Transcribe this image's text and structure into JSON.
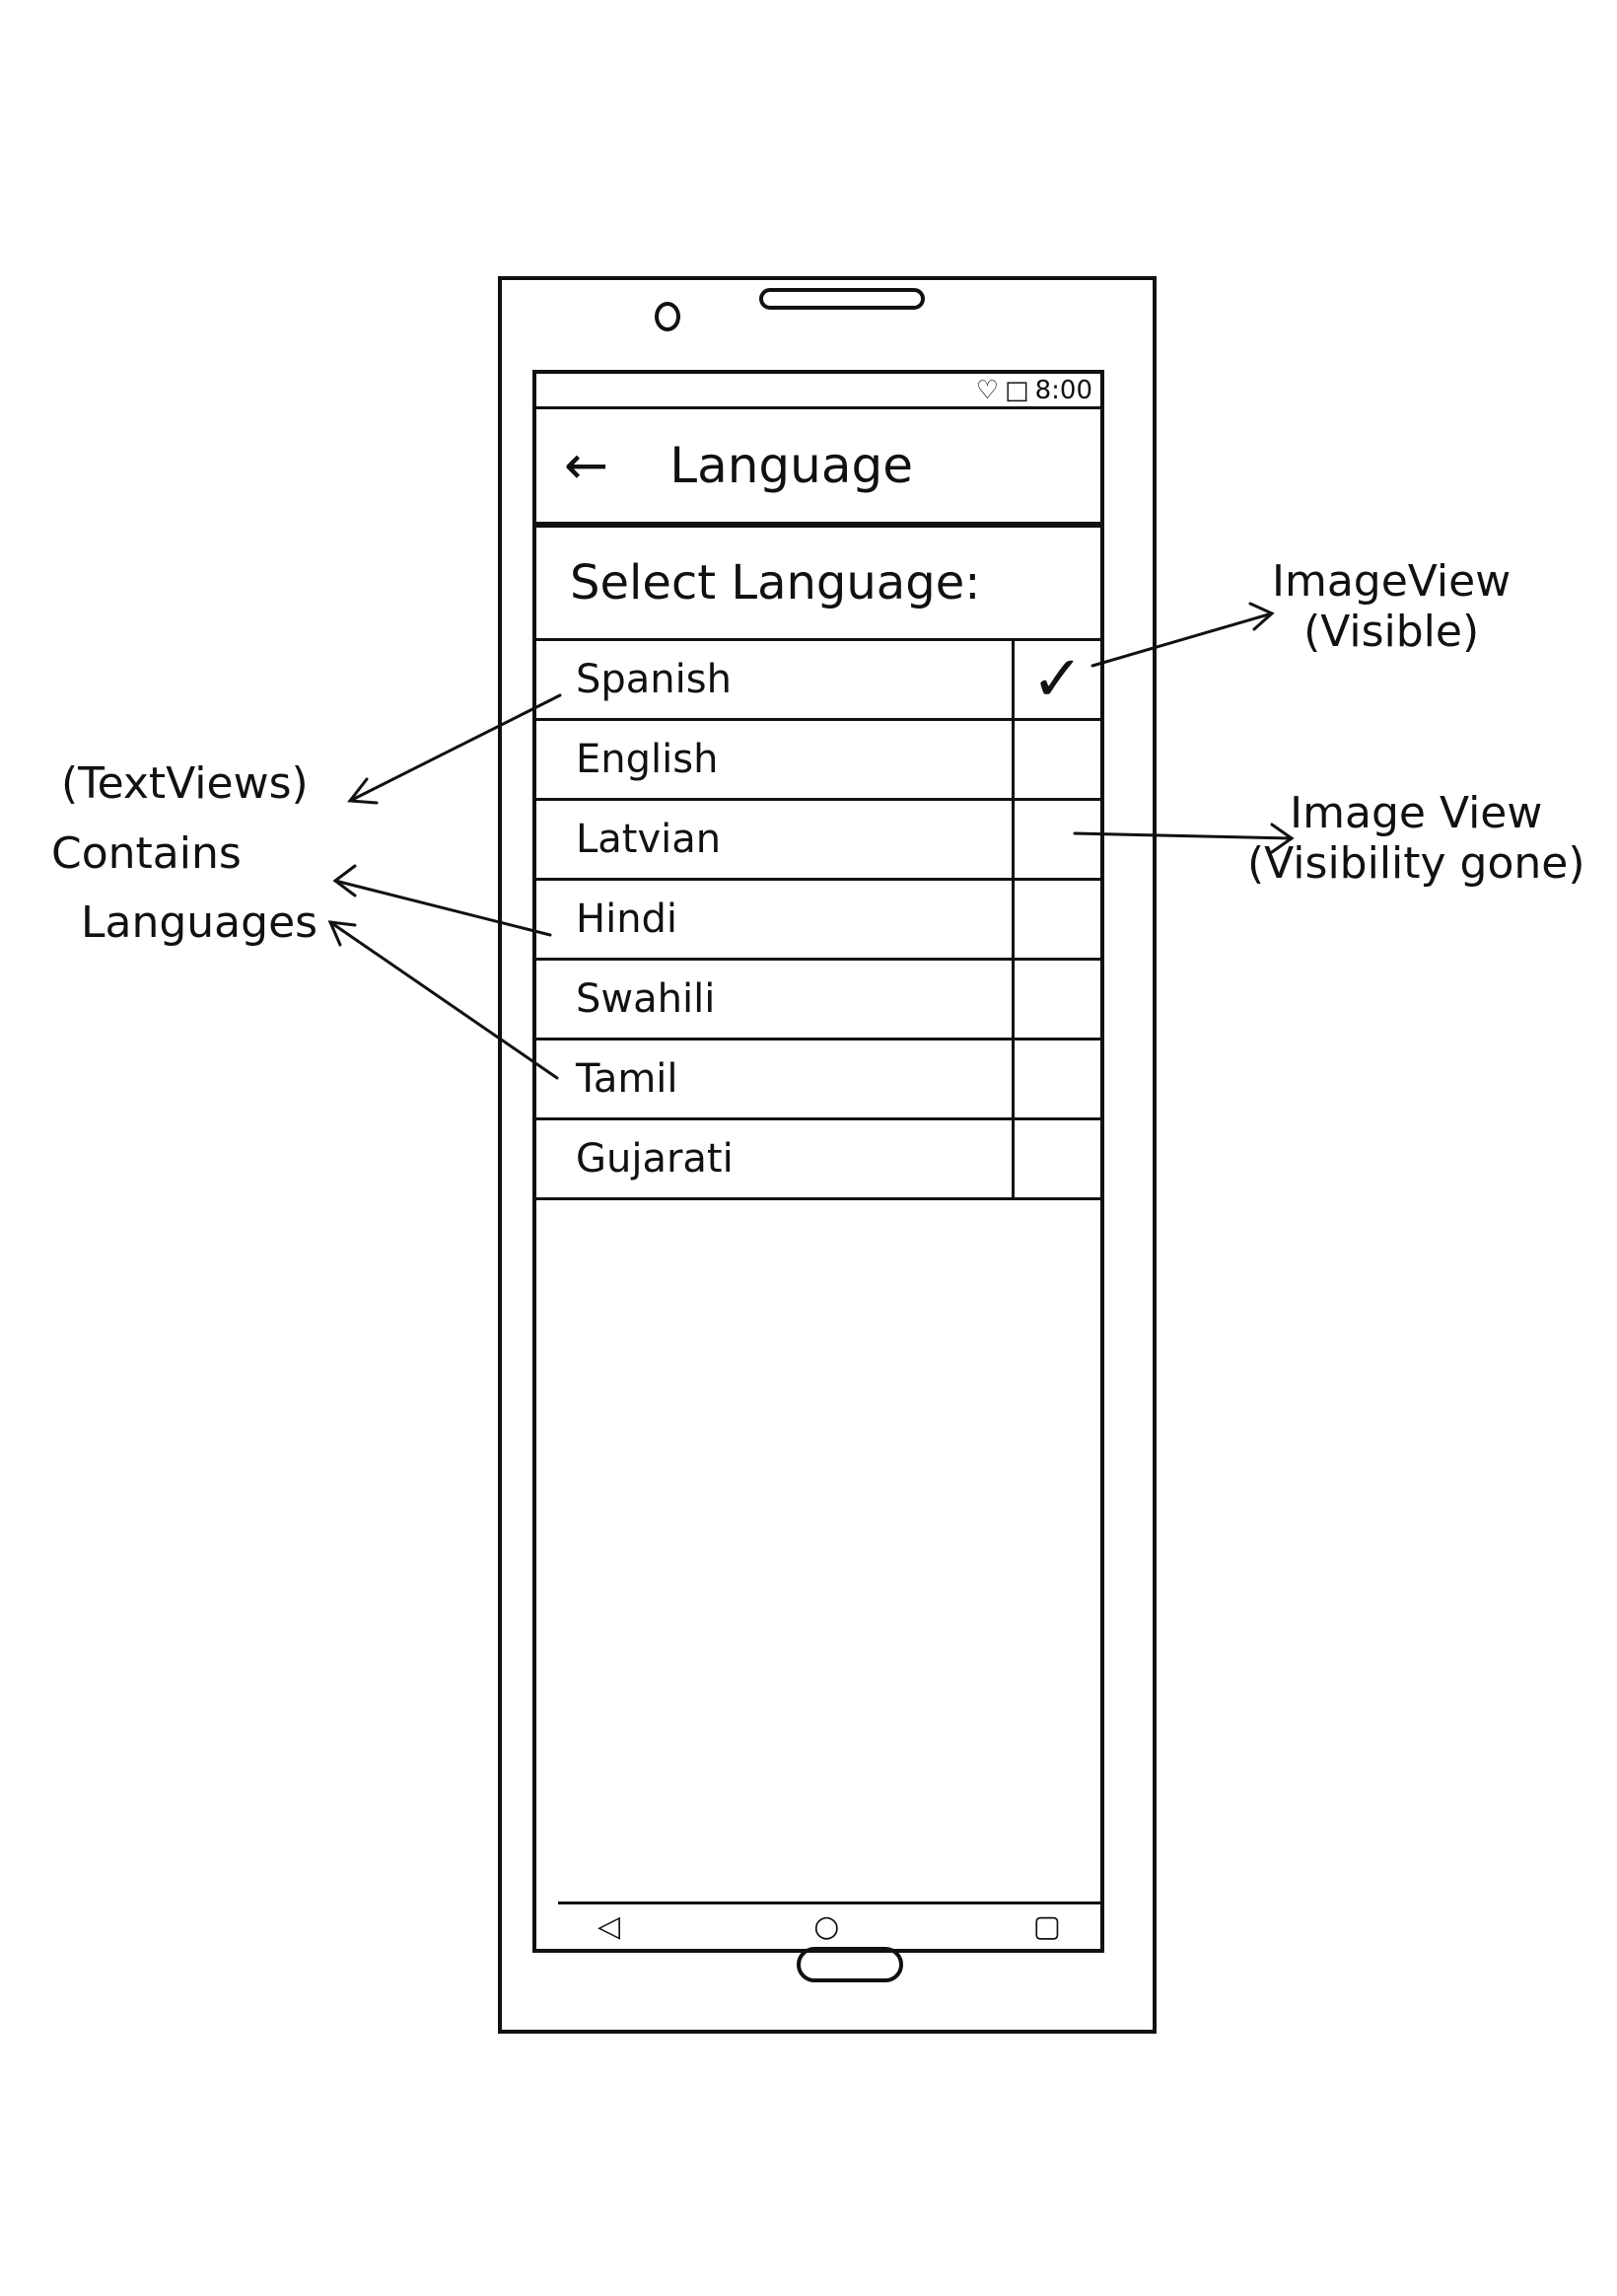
{
  "status_bar": {
    "icons": [
      "location-icon",
      "battery-icon"
    ],
    "time": "8:00"
  },
  "app_bar": {
    "back_icon": "arrow-left-icon",
    "title": "Language"
  },
  "header": {
    "label": "Select Language:"
  },
  "languages": [
    {
      "name": "Spanish",
      "selected": true
    },
    {
      "name": "English",
      "selected": false
    },
    {
      "name": "Latvian",
      "selected": false
    },
    {
      "name": "Hindi",
      "selected": false
    },
    {
      "name": "Swahili",
      "selected": false
    },
    {
      "name": "Tamil",
      "selected": false
    },
    {
      "name": "Gujarati",
      "selected": false
    }
  ],
  "check_glyph": "✓",
  "nav_bar": {
    "back": "◁",
    "home": "○",
    "recents": "▢"
  },
  "annotations": {
    "left": {
      "line1": "(TextViews)",
      "line2": "Contains",
      "line3": "Languages"
    },
    "right_visible": {
      "line1": "ImageView",
      "line2": "(Visible)"
    },
    "right_gone": {
      "line1": "Image View",
      "line2": "(Visibility gone)"
    }
  }
}
